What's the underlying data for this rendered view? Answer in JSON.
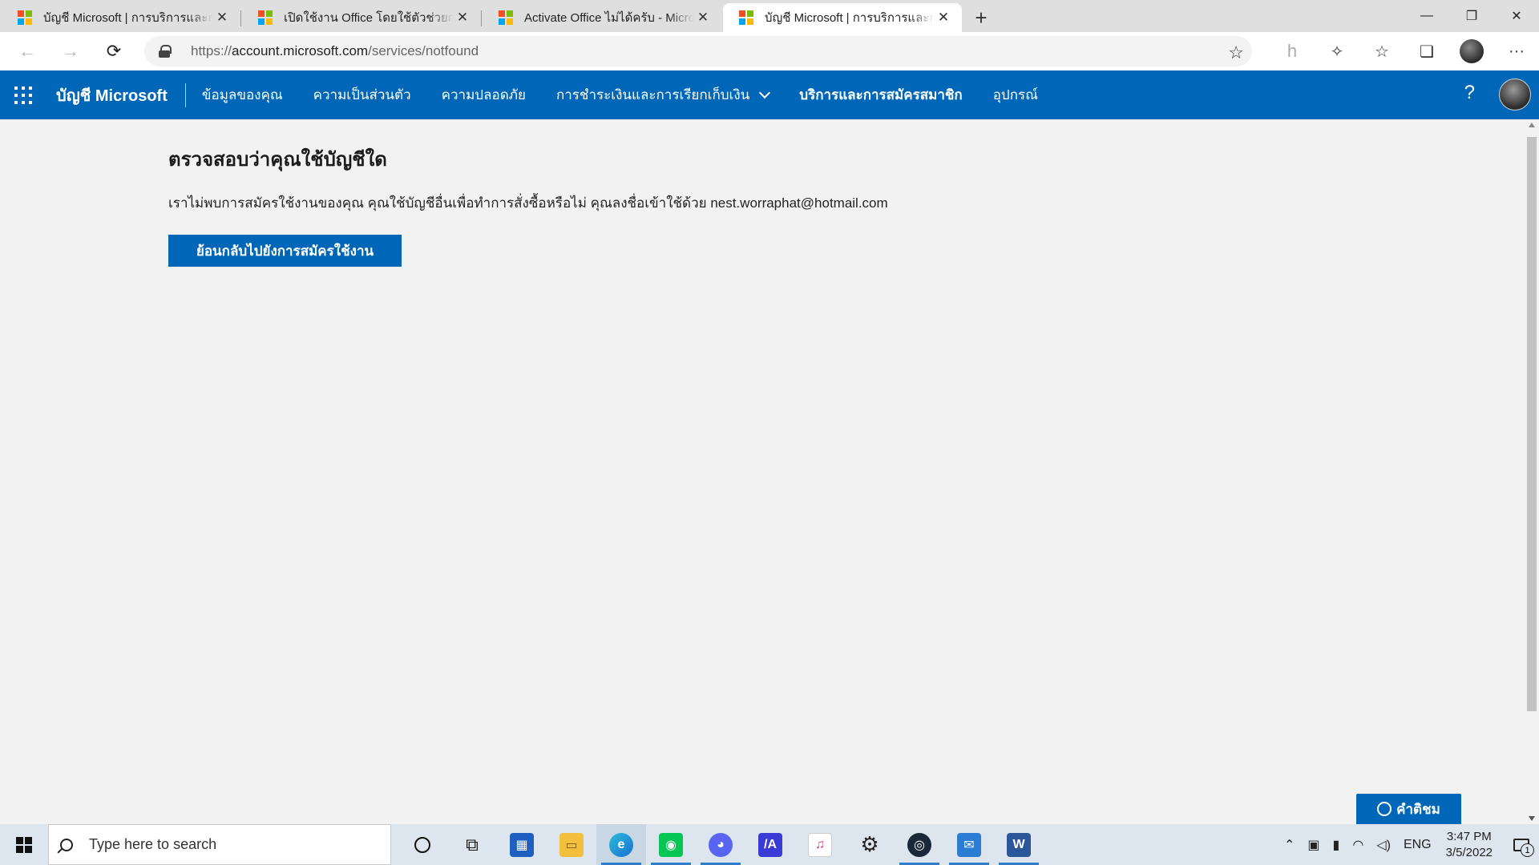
{
  "browser": {
    "tabs": [
      {
        "title": "บัญชี Microsoft | การบริการและการสมัครใช้งาน",
        "active": false
      },
      {
        "title": "เปิดใช้งาน Office โดยใช้ตัวช่วยการเปิดใช้งาน",
        "active": false
      },
      {
        "title": "Activate Office ไม่ได้ครับ - Microsoft Community",
        "active": false
      },
      {
        "title": "บัญชี Microsoft | การบริการและการสมัครใช้งาน",
        "active": true
      }
    ],
    "close_glyph": "✕",
    "new_tab_glyph": "+",
    "url_prefix": "https://",
    "url_host": "account.microsoft.com",
    "url_path": "/services/notfound",
    "window_controls": [
      "—",
      "❐",
      "✕"
    ]
  },
  "header": {
    "brand": "บัญชี Microsoft",
    "nav": [
      {
        "label": "ข้อมูลของคุณ"
      },
      {
        "label": "ความเป็นส่วนตัว"
      },
      {
        "label": "ความปลอดภัย"
      },
      {
        "label": "การชำระเงินและการเรียกเก็บเงิน"
      },
      {
        "label": "บริการและการสมัครสมาชิก"
      },
      {
        "label": "อุปกรณ์"
      }
    ],
    "help": "?"
  },
  "main": {
    "heading": "ตรวจสอบว่าคุณใช้บัญชีใด",
    "message": "เราไม่พบการสมัครใช้งานของคุณ คุณใช้บัญชีอื่นเพื่อทำการสั่งซื้อหรือไม่ คุณลงชื่อเข้าใช้ด้วย nest.worraphat@hotmail.com",
    "back_button": "ย้อนกลับไปยังการสมัครใช้งาน"
  },
  "feedback": {
    "label": "คำติชม"
  },
  "taskbar": {
    "search_placeholder": "Type here to search",
    "language": "ENG",
    "time": "3:47 PM",
    "date": "3/5/2022",
    "notification_count": "1"
  },
  "colors": {
    "accent": "#0067b8",
    "page_bg": "#f2f2f2"
  }
}
